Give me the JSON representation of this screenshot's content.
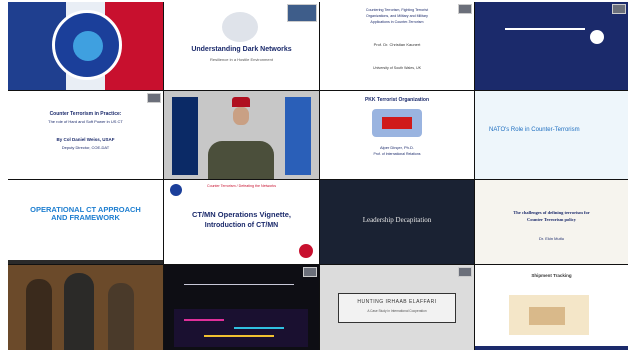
{
  "tiles": {
    "r1c2": {
      "title": "Understanding Dark Networks",
      "subtitle": "Resilience in a Hostile Environment"
    },
    "r1c3": {
      "line1": "Countering Terrorism, Fighting Terrorist",
      "line2": "Organizations, and Military and Military",
      "line3": "Applications in Counter-Terrorism",
      "speaker": "Prof. Dr. Christian Kaunert",
      "affil": "University of South Wales, UK"
    },
    "r2c1": {
      "title": "Counter Terrorism in Practice:",
      "subtitle": "The role of Hard and Soft Power in US CT",
      "speaker": "By Col Daniel Weiss, USAF",
      "role": "Deputy Director, COE-DAT"
    },
    "r2c3": {
      "title": "PKK Terrorist Organization",
      "speaker": "Alper Dinçer, Ph.D.",
      "affil": "Prof. of International Relations"
    },
    "r2c4": {
      "title": "NATO's Role in Counter-Terrorism"
    },
    "r3c1": {
      "title": "OPERATIONAL CT APPROACH AND FRAMEWORK"
    },
    "r3c2": {
      "header": "Counter Terrorism / Defeating the Networks",
      "title": "CT/MN Operations Vignette,",
      "subtitle": "Introduction of CT/MN"
    },
    "r3c3": {
      "title": "Leadership Decapitation"
    },
    "r3c4": {
      "title": "The challenges of defining terrorism for",
      "subtitle": "Counter Terrorism policy",
      "speaker": "Dr. Ekin Mutlu"
    },
    "r4c3": {
      "title": "HUNTING IRHAAB ELAFFARI",
      "subtitle": "A Case Study in International Cooperation"
    },
    "r4c4": {
      "title": "Shipment Tracking"
    }
  },
  "colors": {
    "navy": "#1b2a6b",
    "blue": "#1f5fc9",
    "red": "#c8102e",
    "dark": "#0e0e0e"
  }
}
